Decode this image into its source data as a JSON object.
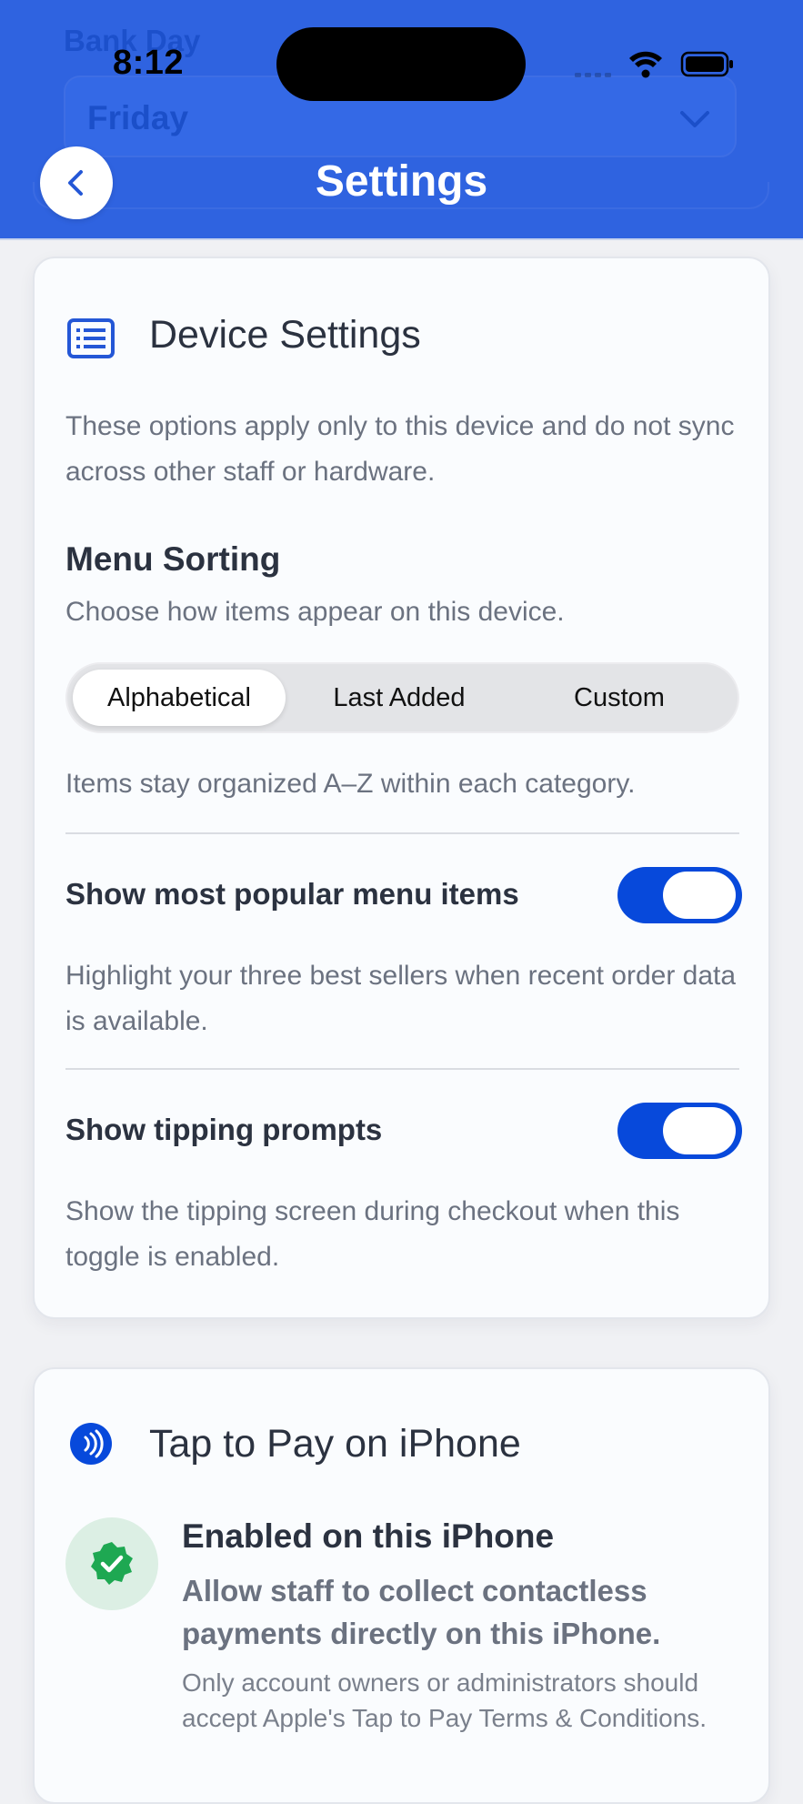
{
  "status_bar": {
    "time": "8:12"
  },
  "background_form": {
    "section_label": "Bank Day",
    "select_value": "Friday"
  },
  "header": {
    "title": "Settings",
    "back_icon": "chevron-left-icon"
  },
  "device_settings": {
    "title": "Device Settings",
    "icon": "list-icon",
    "description": "These options apply only to this device and do not sync across other staff or hardware.",
    "menu_sorting": {
      "title": "Menu Sorting",
      "subtitle": "Choose how items appear on this device.",
      "options": [
        "Alphabetical",
        "Last Added",
        "Custom"
      ],
      "selected": "Alphabetical",
      "hint": "Items stay organized A–Z within each category."
    },
    "popular_items": {
      "label": "Show most popular menu items",
      "enabled": true,
      "description": "Highlight your three best sellers when recent order data is available."
    },
    "tipping": {
      "label": "Show tipping prompts",
      "enabled": true,
      "description": "Show the tipping screen during checkout when this toggle is enabled."
    }
  },
  "tap_to_pay": {
    "title": "Tap to Pay on iPhone",
    "icon": "contactless-icon",
    "status_icon": "verified-check-icon",
    "status_title": "Enabled on this iPhone",
    "status_subtitle": "Allow staff to collect contactless payments directly on this iPhone.",
    "note": "Only account owners or administrators should accept Apple's Tap to Pay Terms & Conditions."
  },
  "colors": {
    "header_blue": "#2f63e0",
    "toggle_on": "#0749db",
    "badge_green": "#1ea852",
    "badge_bg": "#dcefe4"
  }
}
